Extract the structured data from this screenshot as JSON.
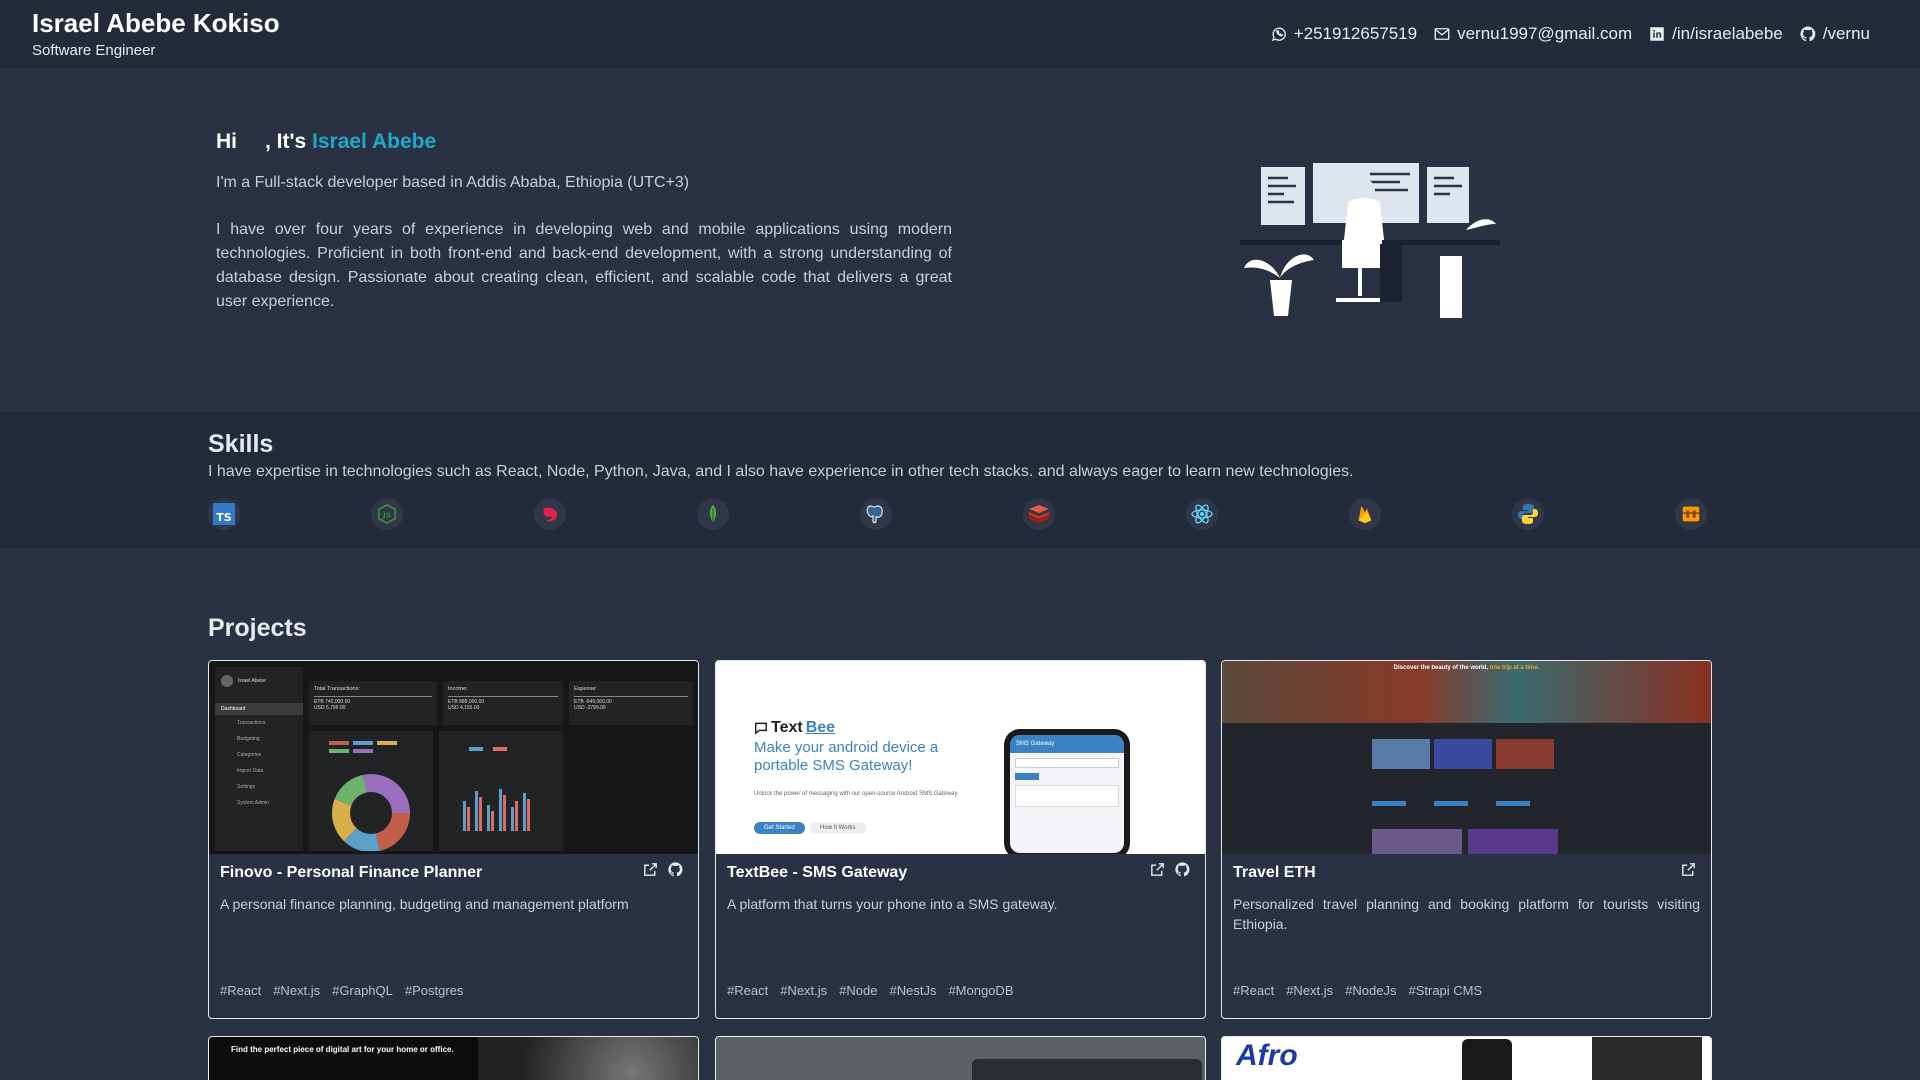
{
  "header": {
    "name": "Israel Abebe Kokiso",
    "role": "Software Engineer",
    "contacts": [
      {
        "icon": "whatsapp-icon",
        "label": "+251912657519"
      },
      {
        "icon": "mail-icon",
        "label": "vernu1997@gmail.com"
      },
      {
        "icon": "linkedin-icon",
        "label": "/in/israelabebe"
      },
      {
        "icon": "github-icon",
        "label": "/vernu"
      }
    ]
  },
  "hero": {
    "greet_prefix": "Hi",
    "greet_mid": ", It's",
    "greet_name": "Israel Abebe",
    "subtitle": "I'm a Full-stack developer based in Addis Ababa, Ethiopia (UTC+3)",
    "description": "I have over four years of experience in developing web and mobile applications using modern technologies. Proficient in both front-end and back-end development, with a strong understanding of database design. Passionate about creating clean, efficient, and scalable code that delivers a great user experience."
  },
  "skills": {
    "title": "Skills",
    "description": "I have expertise in technologies such as React, Node, Python, Java, and I also have experience in other tech stacks. and always eager to learn new technologies.",
    "icons": [
      {
        "name": "typescript-icon",
        "color": "#3178c6"
      },
      {
        "name": "nodejs-icon",
        "color": "#3c873a"
      },
      {
        "name": "nestjs-icon",
        "color": "#e0234e"
      },
      {
        "name": "mongodb-icon",
        "color": "#4db33d"
      },
      {
        "name": "postgresql-icon",
        "color": "#336791"
      },
      {
        "name": "redis-icon",
        "color": "#d82c20"
      },
      {
        "name": "react-icon",
        "color": "#61dafb"
      },
      {
        "name": "firebase-icon",
        "color": "#ffa000"
      },
      {
        "name": "python-icon",
        "color": "#3776ab"
      },
      {
        "name": "aws-icon",
        "color": "#ff9900"
      }
    ]
  },
  "projects": {
    "title": "Projects",
    "items": [
      {
        "title": "Finovo - Personal Finance Planner",
        "description": "A personal finance planning, budgeting and management platform",
        "tags": [
          "#React",
          "#Next.js",
          "#GraphQL",
          "#Postgres"
        ],
        "preview": {
          "user": "Israel Abebe",
          "menu": [
            "Dashboard",
            "Transactions",
            "Budgeting",
            "Categories",
            "Import Data",
            "Settings",
            "System Admin"
          ],
          "stats": [
            {
              "label": "Total Transactions:",
              "v1": "ETB 740,000.00",
              "v2": "USD 5,799.00"
            },
            {
              "label": "Income:",
              "v1": "ETB 885,000.00",
              "v2": "USD 4,156.00"
            },
            {
              "label": "Expense:",
              "v1": "ETB -545,000.00",
              "v2": "USD -2799.00"
            }
          ]
        }
      },
      {
        "title": "TextBee - SMS Gateway",
        "description": "A platform that turns your phone into a SMS gateway.",
        "tags": [
          "#React",
          "#Next.js",
          "#Node",
          "#NestJs",
          "#MongoDB"
        ],
        "preview": {
          "brand_a": "Text",
          "brand_b": "Bee",
          "headline": "Make your android device a portable SMS Gateway!",
          "sub": "Unlock the power of messaging with our open-source Android SMS Gateway.",
          "cta": "Get Started",
          "cta2": "How It Works",
          "phone_title": "SMS Gateway"
        }
      },
      {
        "title": "Travel ETH",
        "description": "Personalized travel planning and booking platform for tourists visiting Ethiopia.",
        "tags": [
          "#React",
          "#Next.js",
          "#NodeJs",
          "#Strapi CMS"
        ],
        "preview": {
          "banner_a": "Discover the beauty of the world,",
          "banner_b": "one trip at a time."
        }
      }
    ],
    "bottom_previews": [
      {
        "text": "Find the perfect piece of digital art for your home or office."
      },
      {
        "text": ""
      },
      {
        "text": "Afro"
      }
    ]
  }
}
